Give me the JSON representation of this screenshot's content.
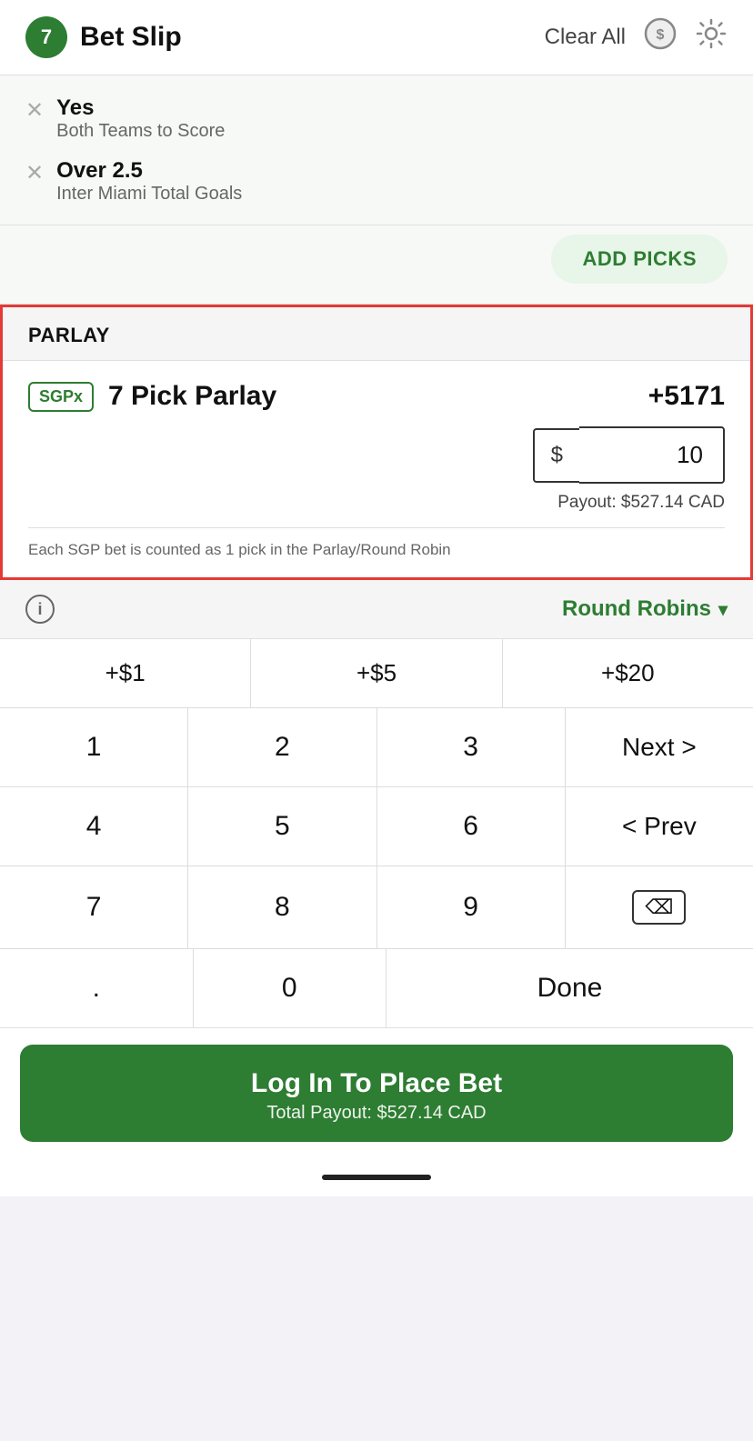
{
  "header": {
    "badge_count": "7",
    "title": "Bet Slip",
    "clear_all_label": "Clear All"
  },
  "picks": [
    {
      "name": "Yes",
      "subtitle": "Both Teams to Score"
    },
    {
      "name": "Over 2.5",
      "subtitle": "Inter Miami Total Goals"
    }
  ],
  "add_picks": {
    "label": "ADD PICKS"
  },
  "parlay": {
    "section_label": "PARLAY",
    "sgpx_badge": "SGPx",
    "pick_name": "7 Pick Parlay",
    "odds": "+5171",
    "dollar_symbol": "$",
    "amount": "10",
    "payout_label": "Payout: $527.14 CAD",
    "note": "Each SGP bet is counted as 1 pick in the Parlay/Round Robin"
  },
  "info_row": {
    "round_robins_label": "Round Robins"
  },
  "quick_add": {
    "buttons": [
      "+$1",
      "+$5",
      "+$20"
    ]
  },
  "keypad": {
    "rows": [
      [
        "1",
        "2",
        "3",
        "Next >"
      ],
      [
        "4",
        "5",
        "6",
        "< Prev"
      ],
      [
        "7",
        "8",
        "9",
        "⌫"
      ],
      [
        ".",
        "0",
        "Done"
      ]
    ]
  },
  "login_btn": {
    "main_label": "Log In To Place Bet",
    "sub_label": "Total Payout: $527.14 CAD"
  }
}
